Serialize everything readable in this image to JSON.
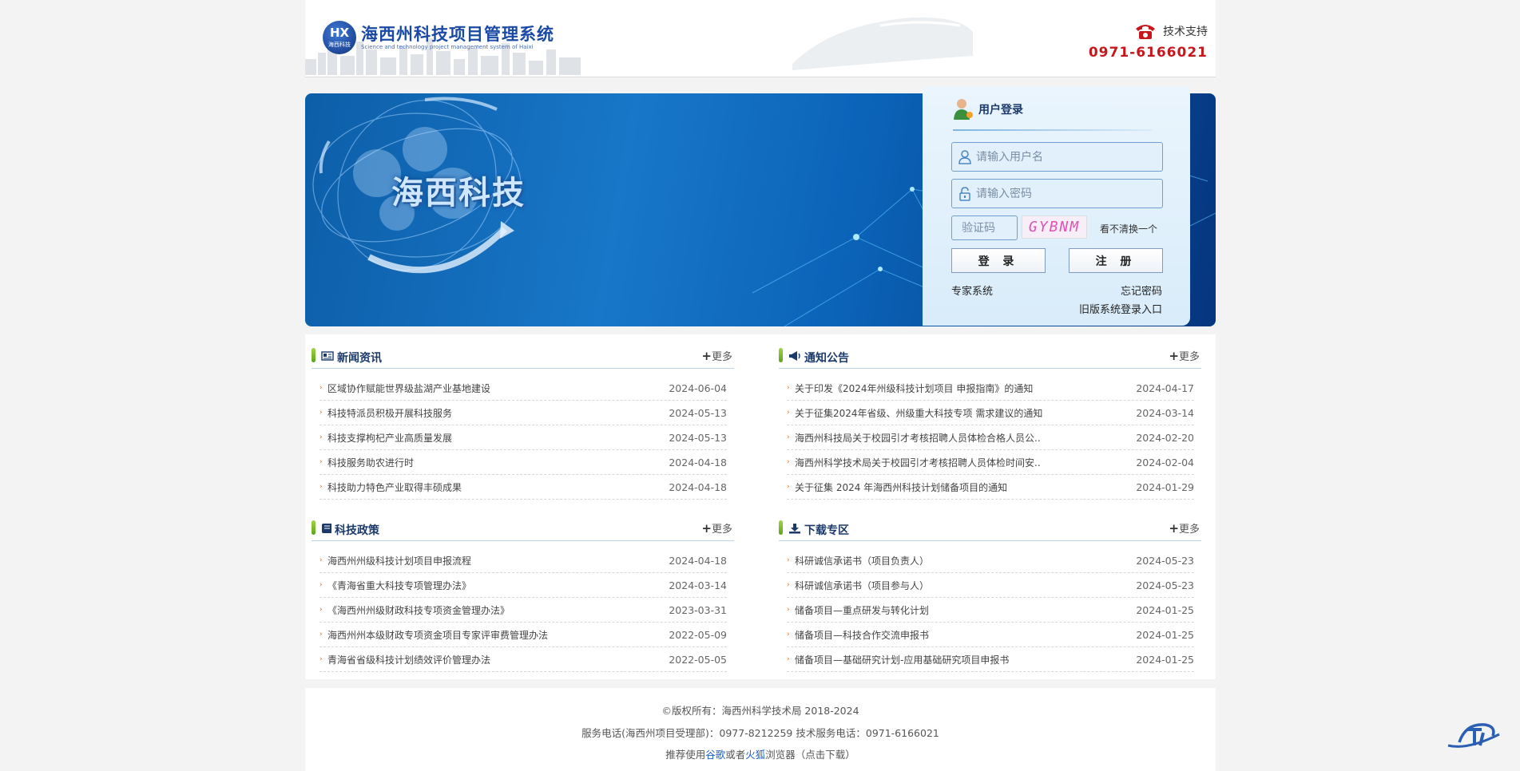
{
  "header": {
    "logo_badge": "HX",
    "logo_badge_sub": "海西科技",
    "title": "海西州科技项目管理系统",
    "subtitle": "Science and technology project management system of Haixi",
    "support_label": "技术支持",
    "support_phone": "0971-6166021"
  },
  "banner": {
    "title": "海西科技"
  },
  "login": {
    "title": "用户登录",
    "username_placeholder": "请输入用户名",
    "password_placeholder": "请输入密码",
    "captcha_placeholder": "验证码",
    "captcha_text": "GYBNM",
    "captcha_refresh": "看不清换一个",
    "login_button": "登 录",
    "register_button": "注 册",
    "expert_link": "专家系统",
    "forgot_link": "忘记密码",
    "old_system_link": "旧版系统登录入口"
  },
  "more_label": "更多",
  "panels": [
    {
      "title": "新闻资讯",
      "icon": "newspaper-icon",
      "items": [
        {
          "title": "区域协作赋能世界级盐湖产业基地建设",
          "date": "2024-06-04"
        },
        {
          "title": "科技特派员积极开展科技服务",
          "date": "2024-05-13"
        },
        {
          "title": "科技支撑枸杞产业高质量发展",
          "date": "2024-05-13"
        },
        {
          "title": "科技服务助农进行时",
          "date": "2024-04-18"
        },
        {
          "title": "科技助力特色产业取得丰硕成果",
          "date": "2024-04-18"
        }
      ]
    },
    {
      "title": "通知公告",
      "icon": "megaphone-icon",
      "items": [
        {
          "title": "关于印发《2024年州级科技计划项目 申报指南》的通知",
          "date": "2024-04-17"
        },
        {
          "title": "关于征集2024年省级、州级重大科技专项 需求建议的通知",
          "date": "2024-03-14"
        },
        {
          "title": "海西州科技局关于校园引才考核招聘人员体检合格人员公..",
          "date": "2024-02-20"
        },
        {
          "title": "海西州科学技术局关于校园引才考核招聘人员体检时间安..",
          "date": "2024-02-04"
        },
        {
          "title": "关于征集 2024 年海西州科技计划储备项目的通知",
          "date": "2024-01-29"
        }
      ]
    },
    {
      "title": "科技政策",
      "icon": "book-icon",
      "items": [
        {
          "title": "海西州州级科技计划项目申报流程",
          "date": "2024-04-18"
        },
        {
          "title": "《青海省重大科技专项管理办法》",
          "date": "2024-03-14"
        },
        {
          "title": "《海西州州级财政科技专项资金管理办法》",
          "date": "2023-03-31"
        },
        {
          "title": "海西州州本级财政专项资金项目专家评审费管理办法",
          "date": "2022-05-09"
        },
        {
          "title": "青海省省级科技计划绩效评价管理办法",
          "date": "2022-05-05"
        }
      ]
    },
    {
      "title": "下载专区",
      "icon": "download-icon",
      "items": [
        {
          "title": "科研诚信承诺书（项目负责人）",
          "date": "2024-05-23"
        },
        {
          "title": "科研诚信承诺书（项目参与人）",
          "date": "2024-05-23"
        },
        {
          "title": "储备项目—重点研发与转化计划",
          "date": "2024-01-25"
        },
        {
          "title": "储备项目—科技合作交流申报书",
          "date": "2024-01-25"
        },
        {
          "title": "储备项目—基础研究计划-应用基础研究项目申报书",
          "date": "2024-01-25"
        }
      ]
    }
  ],
  "footer": {
    "copyright": "©版权所有：海西州科学技术局 2018-2024",
    "service_phone": "服务电话(海西州项目受理部)：0977-8212259 技术服务电话：0971-6166021",
    "rec_prefix": "推荐使用",
    "rec_chrome": "谷歌",
    "rec_or": "或者",
    "rec_firefox": "火狐",
    "rec_suffix": "浏览器（点击下载）"
  },
  "colors": {
    "brand_blue": "#1a4aa6",
    "phone_red": "#c8161d",
    "accent_green": "#5aa31b",
    "bullet_orange": "#e66b0f"
  }
}
